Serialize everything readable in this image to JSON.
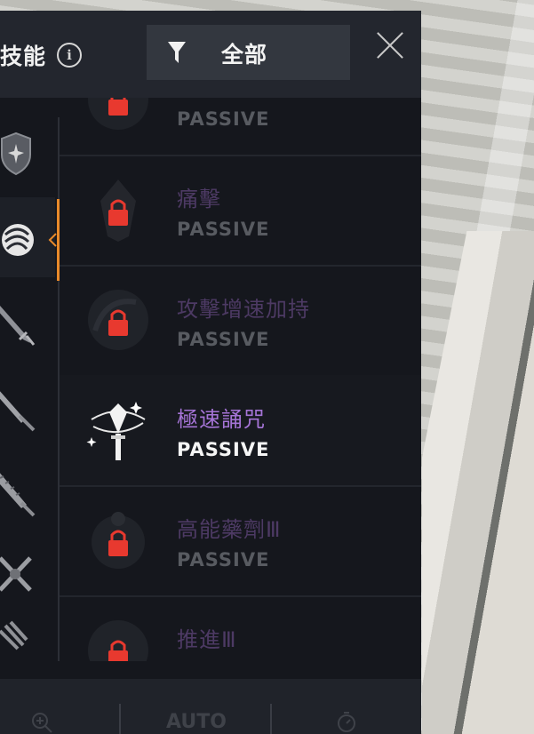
{
  "header": {
    "title": "技能",
    "filter_label": "全部"
  },
  "categories": [
    {
      "icon": "shield-icon"
    },
    {
      "icon": "fist-icon",
      "active": true
    },
    {
      "icon": "dagger-icon"
    },
    {
      "icon": "greatsword-icon"
    },
    {
      "icon": "serrated-sword-icon"
    },
    {
      "icon": "crossed-swords-icon"
    },
    {
      "icon": "claw-icon"
    }
  ],
  "skills": [
    {
      "name": "",
      "type": "PASSIVE",
      "locked": true
    },
    {
      "name": "痛擊",
      "type": "PASSIVE",
      "locked": true
    },
    {
      "name": "攻擊增速加持",
      "type": "PASSIVE",
      "locked": true
    },
    {
      "name": "極速誦咒",
      "type": "PASSIVE",
      "locked": false
    },
    {
      "name": "高能藥劑Ⅲ",
      "type": "PASSIVE",
      "locked": true
    },
    {
      "name": "推進Ⅲ",
      "type": "",
      "locked": true
    }
  ],
  "footer": {
    "auto_label": "AUTO"
  },
  "colors": {
    "accent_orange": "#e98a2a",
    "lock_red": "#e8392f",
    "skill_name_purple": "#a574d6"
  }
}
